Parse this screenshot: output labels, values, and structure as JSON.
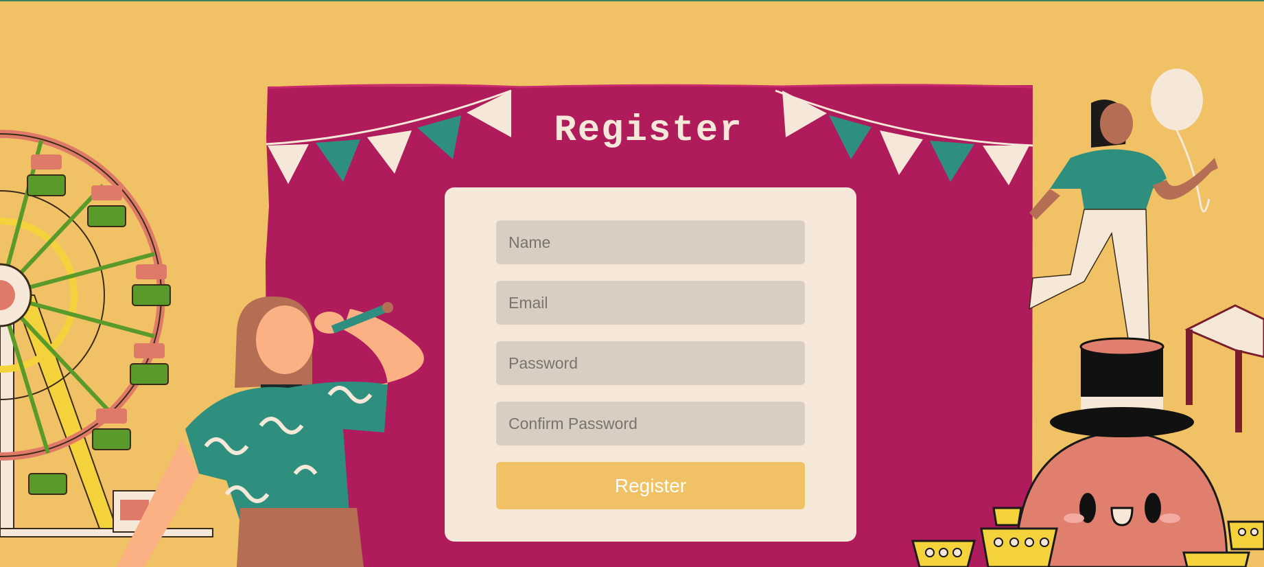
{
  "page": {
    "title": "Register"
  },
  "form": {
    "name_placeholder": "Name",
    "email_placeholder": "Email",
    "password_placeholder": "Password",
    "confirm_placeholder": "Confirm Password",
    "submit_label": "Register"
  },
  "colors": {
    "background": "#f0c265",
    "panel": "#b01b5c",
    "card": "#f6e8d8",
    "input": "#d9cec2",
    "button": "#f0c265",
    "accent_teal": "#2f8f7f"
  },
  "illustrations": [
    "ferris-wheel",
    "bunting-flags",
    "person-with-telescope",
    "girl-with-balloon",
    "octopus-with-top-hat",
    "teacups",
    "wooden-stool"
  ]
}
